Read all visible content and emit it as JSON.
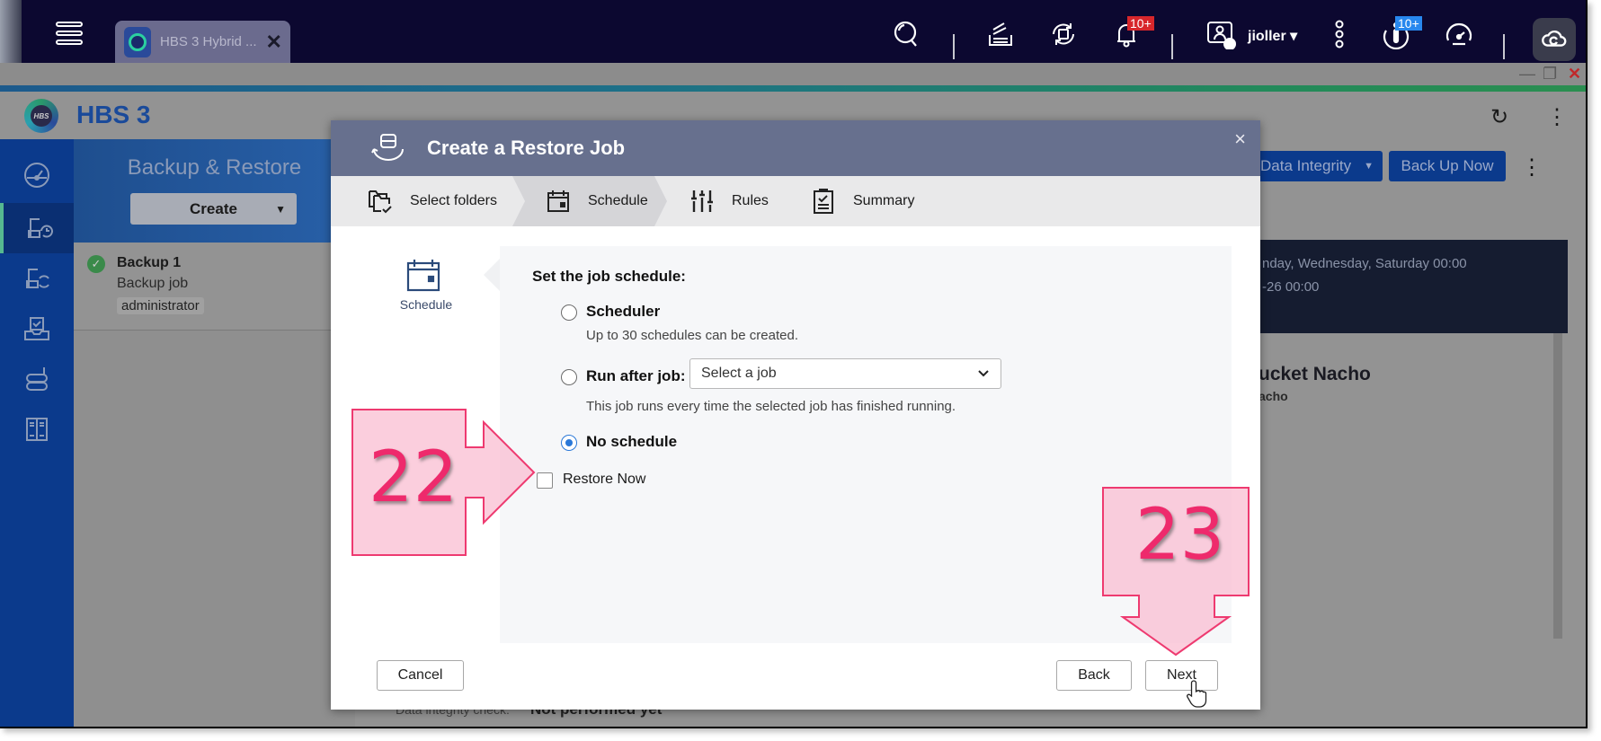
{
  "system_bar": {
    "app_tab": {
      "label": "HBS 3 Hybrid ...",
      "icon": "hbs-app-icon"
    },
    "icons": [
      "search-icon",
      "stack-icon",
      "sync-icon",
      "bell-icon",
      "user-icon",
      "more-vertical-icon",
      "info-icon",
      "dashboard-icon",
      "cloud-icon"
    ],
    "notifications_badge": "10+",
    "info_badge": "10+",
    "username": "jioller",
    "colors": {
      "bar": "#0c0830",
      "red_badge": "#d7262b",
      "blue_badge": "#2888ee"
    }
  },
  "window": {
    "controls": {
      "minimize": "—",
      "restore": "❐",
      "close": "✕"
    }
  },
  "app_header": {
    "title": "HBS 3",
    "logo_text": "HBS",
    "refresh_icon": "↻",
    "more_icon": "⋮"
  },
  "left_nav": {
    "items": [
      {
        "name": "overview",
        "icon": "gauge-icon",
        "active": false
      },
      {
        "name": "backup-restore",
        "icon": "backup-restore-icon",
        "active": true
      },
      {
        "name": "sync",
        "icon": "sync-device-icon",
        "active": false
      },
      {
        "name": "storage-space",
        "icon": "inbox-tray-icon",
        "active": false
      },
      {
        "name": "services",
        "icon": "server-icon",
        "active": false
      },
      {
        "name": "logs",
        "icon": "locker-icon",
        "active": false
      }
    ]
  },
  "backup_panel": {
    "title": "Backup & Restore",
    "create_label": "Create",
    "jobs": [
      {
        "name": "Backup 1",
        "type": "Backup job",
        "owner": "administrator",
        "status": "ok"
      }
    ]
  },
  "main_background": {
    "data_integrity_label": "Data Integrity",
    "back_up_now_label": "Back Up Now",
    "schedule_line1": "nday, Wednesday, Saturday 00:00",
    "schedule_line2": "-26 00:00",
    "bucket_name": "ucket Nacho",
    "bucket_sub": "acho",
    "data_integrity_check_label": "Data integrity check:",
    "data_integrity_check_value": "Not performed yet"
  },
  "dialog": {
    "title": "Create a Restore Job",
    "close_label": "×",
    "steps": [
      {
        "label": "Select folders",
        "icon": "folders-check-icon",
        "active": false
      },
      {
        "label": "Schedule",
        "icon": "calendar-icon",
        "active": true
      },
      {
        "label": "Rules",
        "icon": "sliders-icon",
        "active": false
      },
      {
        "label": "Summary",
        "icon": "clipboard-check-icon",
        "active": false
      }
    ],
    "side_label": "Schedule",
    "section_title": "Set the job schedule:",
    "options": {
      "scheduler": {
        "label": "Scheduler",
        "desc": "Up to 30 schedules can be created.",
        "selected": false
      },
      "run_after": {
        "label": "Run after job:",
        "select_value": "Select a job",
        "desc": "This job runs every time the selected job has finished running.",
        "selected": false
      },
      "no_schedule": {
        "label": "No schedule",
        "selected": true
      }
    },
    "restore_now": {
      "label": "Restore Now",
      "checked": false
    },
    "buttons": {
      "cancel": "Cancel",
      "back": "Back",
      "next": "Next"
    },
    "colors": {
      "title_bar": "#67708e",
      "accent": "#2a78d8"
    }
  },
  "annotations": [
    {
      "number": "22",
      "direction": "right",
      "target": "Restore Now"
    },
    {
      "number": "23",
      "direction": "down",
      "target": "Next"
    }
  ],
  "annotation_color": "#ee2a6c"
}
